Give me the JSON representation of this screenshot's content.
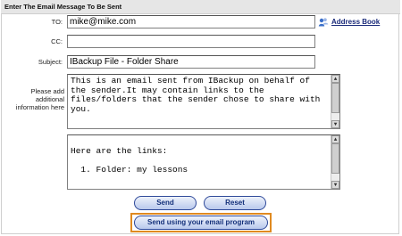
{
  "header": {
    "title": "Enter The Email Message To Be Sent"
  },
  "form": {
    "to_label": "TO:",
    "to_value": "mike@mike.com",
    "cc_label": "CC:",
    "cc_value": "",
    "subject_label": "Subject:",
    "subject_value": "IBackup File - Folder Share",
    "message_label": "Please add additional information here",
    "message_text": "This is an email sent from IBackup on behalf of the sender.It may contain links to the files/folders that the sender chose to share with you.",
    "links_text": "\nHere are the links:\n\n  1. Folder: my lessons"
  },
  "address_book": {
    "label": "Address Book",
    "icon": "address-book-icon"
  },
  "buttons": {
    "send": "Send",
    "reset": "Reset",
    "send_email_program": "Send using your email program"
  },
  "colors": {
    "accent_highlight": "#e08a20",
    "button_text": "#13307a",
    "header_bg": "#e6e6e6"
  }
}
